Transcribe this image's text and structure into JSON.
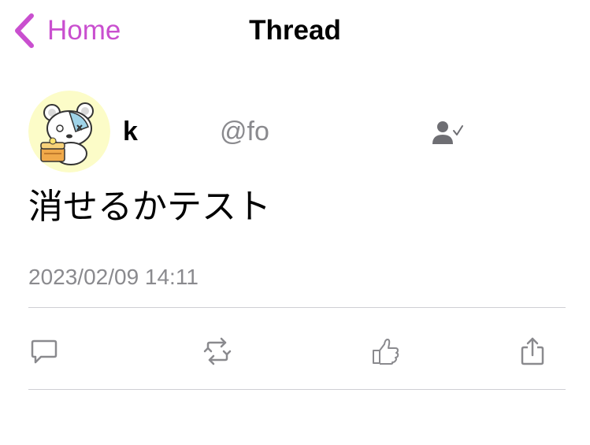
{
  "nav": {
    "back_label": "Home",
    "title": "Thread"
  },
  "post": {
    "author": {
      "display_name": "k",
      "handle": "@fo"
    },
    "text": "消せるかテスト",
    "timestamp": "2023/02/09 14:11"
  },
  "icons": {
    "back": "chevron-left-icon",
    "follow": "person-check-icon",
    "reply": "speech-bubble-icon",
    "repost": "repost-arrows-icon",
    "like": "thumbs-up-icon",
    "share": "share-icon"
  },
  "colors": {
    "accent": "#c94fcf",
    "secondary_text": "#8a8a8e",
    "divider": "#cfcfd4",
    "avatar_bg": "#fcfcc8",
    "icon_gray": "#8a8a8e"
  }
}
